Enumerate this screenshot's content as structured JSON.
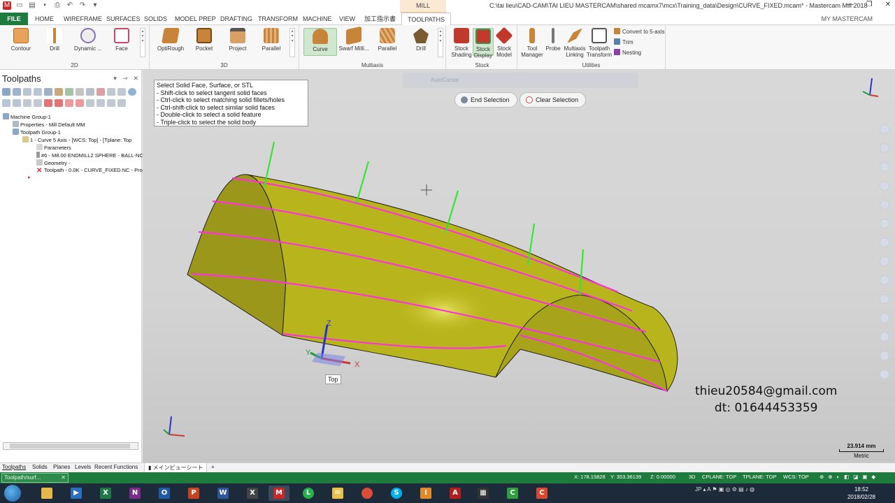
{
  "window": {
    "context_tab": "MILL",
    "title": "C:\\tai lieu\\CAD-CAM\\TAI LIEU MASTERCAM\\shared mcamx7\\mcx\\Training_data\\Design\\CURVE_FIXED.mcam* - Mastercam Mill 2018",
    "my_mastercam": "MY MASTERCAM"
  },
  "tabs": [
    "FILE",
    "HOME",
    "WIREFRAME",
    "SURFACES",
    "SOLIDS",
    "MODEL PREP",
    "DRAFTING",
    "TRANSFORM",
    "MACHINE",
    "VIEW",
    "加工指示書",
    "TOOLPATHS"
  ],
  "ribbon": {
    "group_2d": {
      "label": "2D",
      "buttons": [
        "Contour",
        "Drill",
        "Dynamic ...",
        "Face"
      ]
    },
    "group_3d": {
      "label": "3D",
      "buttons": [
        "OptiRough",
        "Pocket",
        "Project",
        "Parallel"
      ]
    },
    "group_multiaxis": {
      "label": "Multiaxis",
      "buttons": [
        "Curve",
        "Swarf Milli...",
        "Parallel",
        "Drill"
      ]
    },
    "group_stock": {
      "label": "Stock",
      "buttons": [
        "Stock Shading",
        "Stock Display",
        "Stock Model"
      ]
    },
    "group_utilities": {
      "label": "Utilities",
      "buttons": [
        "Tool Manager",
        "Probe",
        "Multiaxis Linking",
        "Toolpath Transform"
      ],
      "small": [
        "Convert to 5-axis",
        "Trim",
        "Nesting"
      ]
    }
  },
  "panel": {
    "title": "Toolpaths",
    "tree": [
      "Machine Group-1",
      "Properties - Mill Default MM",
      "Toolpath Group-1",
      "1 - Curve 5 Axis - [WCS: Top] - [Tplane: Top",
      "Parameters",
      "#6 - M8.00 ENDMILL2 SPHERE - BALL-NC",
      "Geometry -",
      "Toolpath - 0.0K - CURVE_FIXED.NC - Pro"
    ]
  },
  "viewport": {
    "hint_lines": [
      "Select Solid Face, Surface, or STL",
      "- Shift-click to select tangent solid faces",
      "- Ctrl-click to select matching solid fillets/holes",
      "- Ctrl-shift-click to select similar solid faces",
      "- Double-click to select a solid feature",
      "- Triple-click to select the solid body"
    ],
    "autocursor": "AutoCursor",
    "end_selection": "End Selection",
    "clear_selection": "Clear Selection",
    "view_label": "Top",
    "axis_x": "X",
    "axis_y": "Y",
    "axis_z": "Z",
    "watermark_email": "thieu20584@gmail.com",
    "watermark_phone": "dt: 01644453359",
    "scale_value": "23.914 mm",
    "scale_unit": "Metric"
  },
  "bottom_tabs": [
    "Toolpaths",
    "Solids",
    "Planes",
    "Levels",
    "Recent Functions"
  ],
  "sheet_tab": "メインビューシート",
  "sheet_add": "+",
  "status": {
    "left_text": "Toolpath/surf...",
    "close": "✕",
    "x": "X:   178.15828",
    "y": "Y:   353.36139",
    "z": "Z:   0.00000",
    "mode": "3D",
    "cplane": "CPLANE: TOP",
    "tplane": "TPLANE: TOP",
    "wcs": "WCS: TOP"
  },
  "taskbar": {
    "tray": "JP",
    "time": "18:52",
    "date": "2018/02/28"
  },
  "colors": {
    "accent_green": "#1f7a3e",
    "surface_yellow": "#b8b41c",
    "curve_magenta": "#ff33dd",
    "vector_green": "#33e633"
  }
}
